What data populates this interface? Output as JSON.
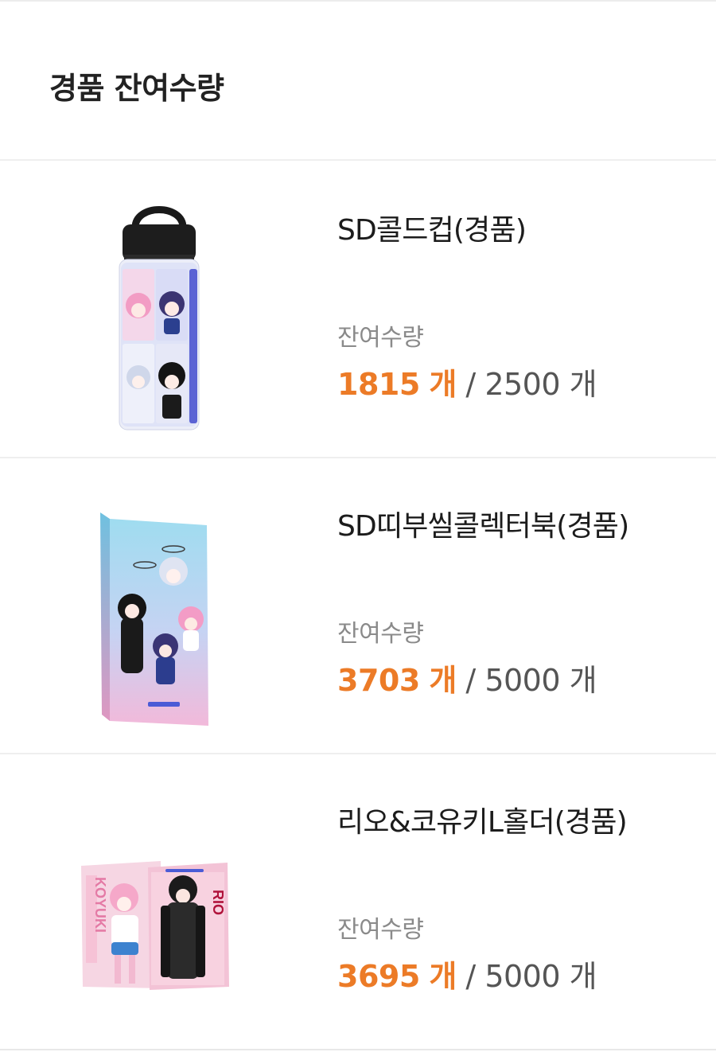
{
  "header": {
    "title": "경품 잔여수량"
  },
  "items": [
    {
      "name": "SD콜드컵(경품)",
      "label": "잔여수량",
      "remaining": "1815",
      "total": "2500",
      "unit": "개",
      "separator": "/",
      "image": "cold-cup-bottle-image"
    },
    {
      "name": "SD띠부씰콜렉터북(경품)",
      "label": "잔여수량",
      "remaining": "3703",
      "total": "5000",
      "unit": "개",
      "separator": "/",
      "image": "sticker-collector-book-image"
    },
    {
      "name": "리오&코유키L홀더(경품)",
      "label": "잔여수량",
      "remaining": "3695",
      "total": "5000",
      "unit": "개",
      "separator": "/",
      "image": "l-holder-folders-image"
    }
  ],
  "thumb_text": {
    "folder_left": "KOYUKI",
    "folder_right": "RIO"
  },
  "colors": {
    "accent": "#ec7b27",
    "muted": "#8a8a8a",
    "divider": "#efefef"
  }
}
